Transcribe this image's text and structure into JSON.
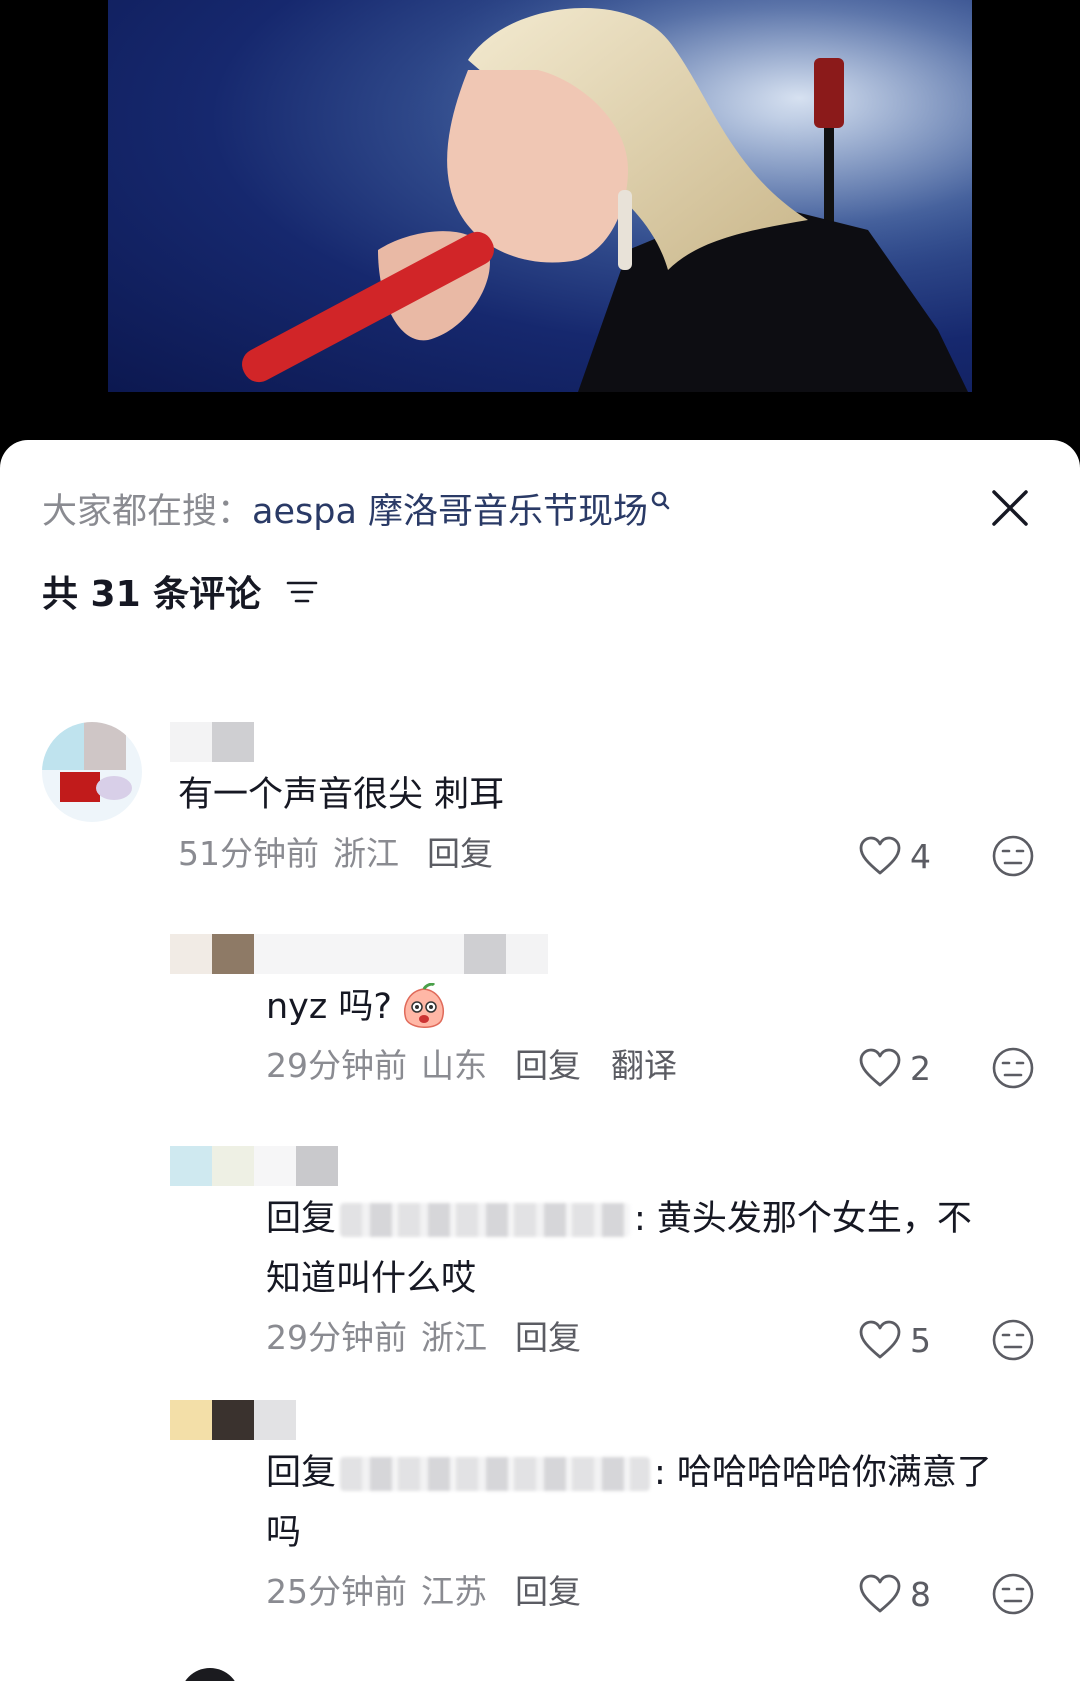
{
  "search_hint": {
    "prefix": "大家都在搜：",
    "term": "aespa 摩洛哥音乐节现场"
  },
  "comment_count": "共 31 条评论",
  "comments": [
    {
      "text": "有一个声音很尖 刺耳",
      "time": "51分钟前",
      "location": "浙江",
      "reply": "回复",
      "likes": "4"
    },
    {
      "text": "nyz 吗?",
      "time": "29分钟前",
      "location": "山东",
      "reply": "回复",
      "translate": "翻译",
      "likes": "2"
    },
    {
      "reply_prefix": "回复",
      "text_line1": ": 黄头发那个女生，不",
      "text_line2": "知道叫什么哎",
      "time": "29分钟前",
      "location": "浙江",
      "reply": "回复",
      "likes": "5"
    },
    {
      "reply_prefix": "回复",
      "text_line1": ": 哈哈哈哈哈你满意了",
      "text_line2": "吗",
      "time": "25分钟前",
      "location": "江苏",
      "reply": "回复",
      "likes": "8"
    }
  ],
  "colors": {
    "sheet_bg": "#ffffff",
    "text": "#161823",
    "secondary": "#8a8b91",
    "search_term": "#2a3a66"
  }
}
